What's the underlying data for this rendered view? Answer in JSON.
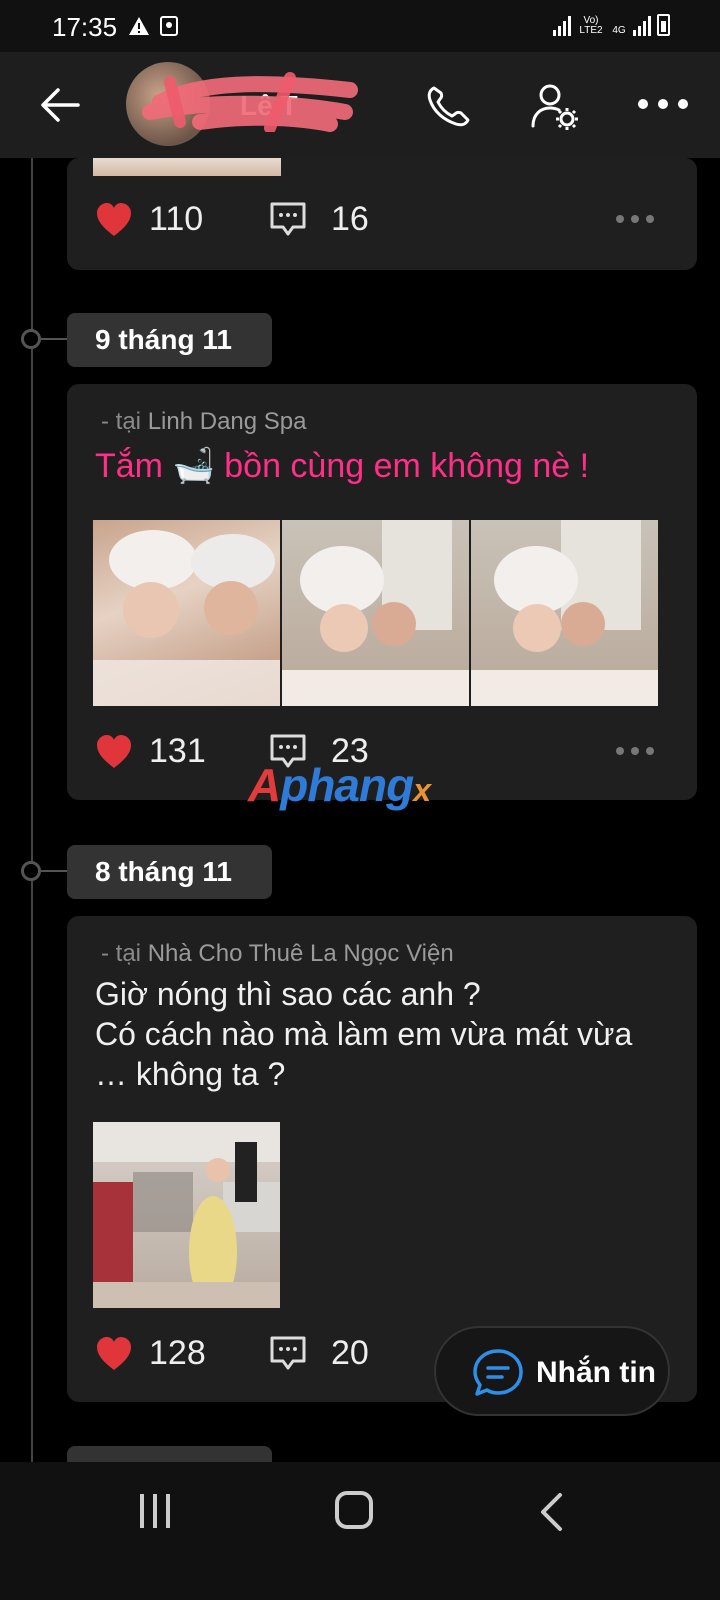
{
  "status_bar": {
    "time": "17:35",
    "lte_label": "Vo) LTE2",
    "network_label": "4G"
  },
  "header": {
    "name": "Lê T",
    "icons": [
      "back-arrow-icon",
      "phone-icon",
      "profile-settings-icon",
      "more-icon"
    ]
  },
  "timeline": [
    {
      "date": "",
      "like_count": "110",
      "comment_count": "16"
    },
    {
      "date": "9 tháng 11",
      "location_prefix": "- tại ",
      "location_name": "Linh Dang Spa",
      "text_before": "Tắm",
      "text_emoji": "🛁",
      "text_after": "bồn cùng em không nè !",
      "like_count": "131",
      "comment_count": "23"
    },
    {
      "date": "8 tháng 11",
      "location_prefix": "- tại ",
      "location_name": "Nhà Cho Thuê La Ngọc Viện",
      "text_line1": "Giờ nóng thì sao các anh ?",
      "text_line2": "Có cách nào mà làm em vừa mát vừa",
      "text_line3": "… không ta ?",
      "like_count": "128",
      "comment_count": "20"
    }
  ],
  "watermark": {
    "part1": "A",
    "part2": "phang",
    "part3": "x"
  },
  "fab": {
    "label": "Nhắn tin"
  },
  "colors": {
    "background": "#000000",
    "card": "#1f1f1f",
    "chip": "#333333",
    "like_red": "#e0353b",
    "pink_text": "#ff2f87",
    "fab_icon_blue": "#2e8fe8"
  }
}
